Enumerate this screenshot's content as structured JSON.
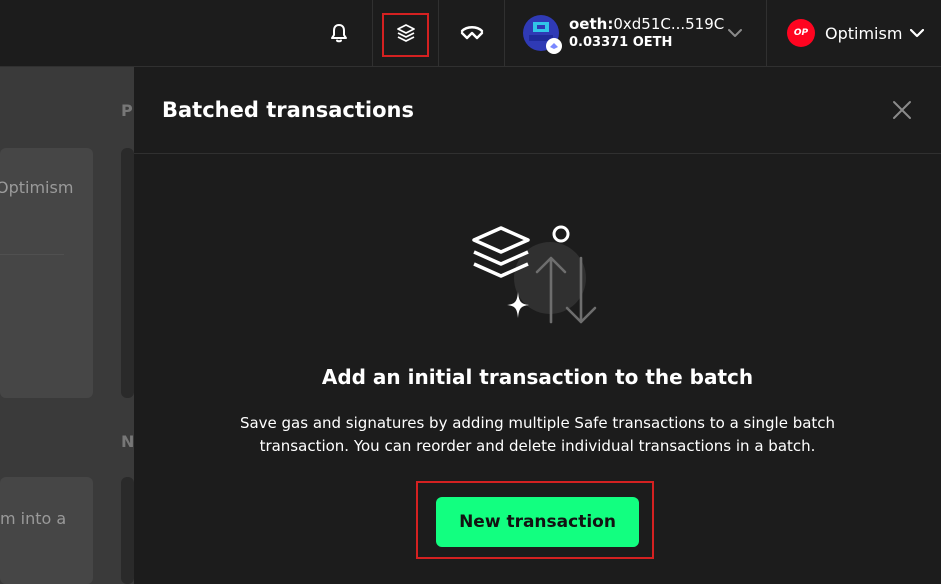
{
  "header": {
    "account": {
      "prefix": "oeth:",
      "address": "0xd51C...519C",
      "balance": "0.03371 OETH"
    },
    "network": {
      "badge": "OP",
      "name": "Optimism"
    }
  },
  "background": {
    "heading_1_fragment": "P",
    "heading_2_fragment": "N",
    "card_1_text_fragment": "Optimism",
    "card_2_text_fragment": "m into a"
  },
  "drawer": {
    "title": "Batched transactions",
    "empty_title": "Add an initial transaction to the batch",
    "empty_description": "Save gas and signatures by adding multiple Safe transactions to a single batch transaction. You can reorder and delete individual transactions in a batch.",
    "new_transaction_label": "New transaction"
  },
  "colors": {
    "accent": "#12ff80",
    "highlight": "#d42121",
    "op_red": "#ff0420"
  }
}
